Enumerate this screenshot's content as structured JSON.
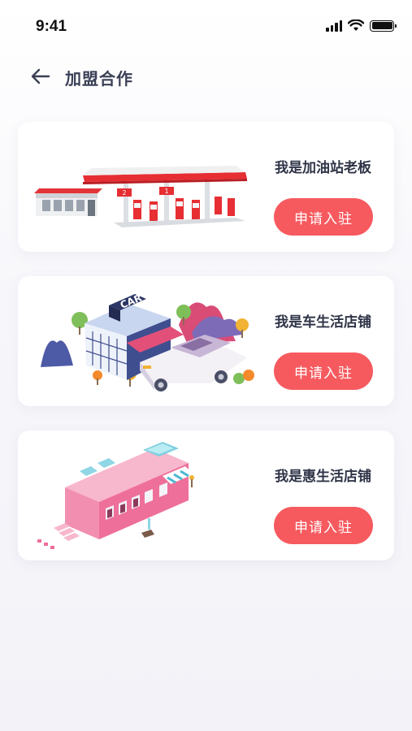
{
  "status_bar": {
    "time": "9:41"
  },
  "header": {
    "title": "加盟合作"
  },
  "cards": [
    {
      "title": "我是加油站老板",
      "button_label": "申请入驻",
      "illustration": "gas-station-illustration"
    },
    {
      "title": "我是车生活店铺",
      "button_label": "申请入驻",
      "illustration": "car-shop-illustration",
      "sign_text": "CAR"
    },
    {
      "title": "我是惠生活店铺",
      "button_label": "申请入驻",
      "illustration": "pink-shop-illustration"
    }
  ],
  "colors": {
    "accent": "#f65a5f",
    "title": "#2f3447",
    "background": "#f4f4f9"
  }
}
